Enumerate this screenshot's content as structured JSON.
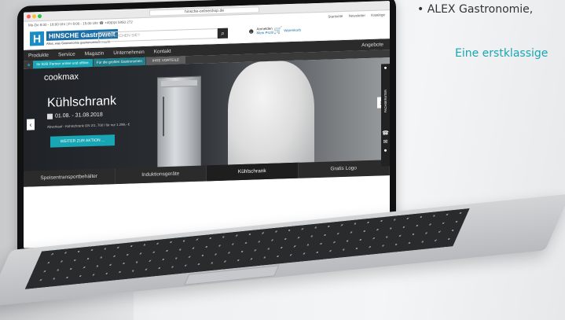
{
  "marketing": {
    "line1": "• ALEX Gastronomie,",
    "line2": "Eine erstklassige"
  },
  "browser": {
    "url": "hinsche-onlineshop.de"
  },
  "top_strip": {
    "hours": "Mo-Do 8:00 - 18:00 Uhr | Fr 8:00 - 15:00 Uhr",
    "phone": "+49(0)4 5950 272",
    "links": [
      "Startseite",
      "Newsletter",
      "Kataloge"
    ]
  },
  "header": {
    "logo_letter": "H",
    "logo_name": "HINSCHE Gastrowelt",
    "logo_claim": "Alles, was Gastronomie gastronomisch macht",
    "search_placeholder": "WAS SUCHEN SIE?",
    "login": "Anmelden",
    "login_sub": "Mein Profil",
    "cart": "Warenkorb"
  },
  "nav": {
    "items": [
      "Produkte",
      "Service",
      "Magazin",
      "Unternehmen",
      "Kontakt"
    ],
    "right": "Angebote"
  },
  "promo": {
    "intro": "Ihr B2B Partner online und offline.",
    "seg": "Für die großen Gastronomen",
    "vorteile": "IHRE VORTEILE"
  },
  "hero": {
    "brand": "cookmax",
    "title": "Kühlschrank",
    "date": "01.08. - 31.08.2018",
    "subtitle": "Abverkauf - Kühlschrank GN 2/1, 700 l für nur 1.299,- €",
    "cta": "WEITER ZUR AKTION ..."
  },
  "sidebar": {
    "label": "FACHBERATER"
  },
  "tabs": [
    "Speisentransportbehälter",
    "Induktionsgeräte",
    "Kühlschrank",
    "Gratis Logo"
  ]
}
